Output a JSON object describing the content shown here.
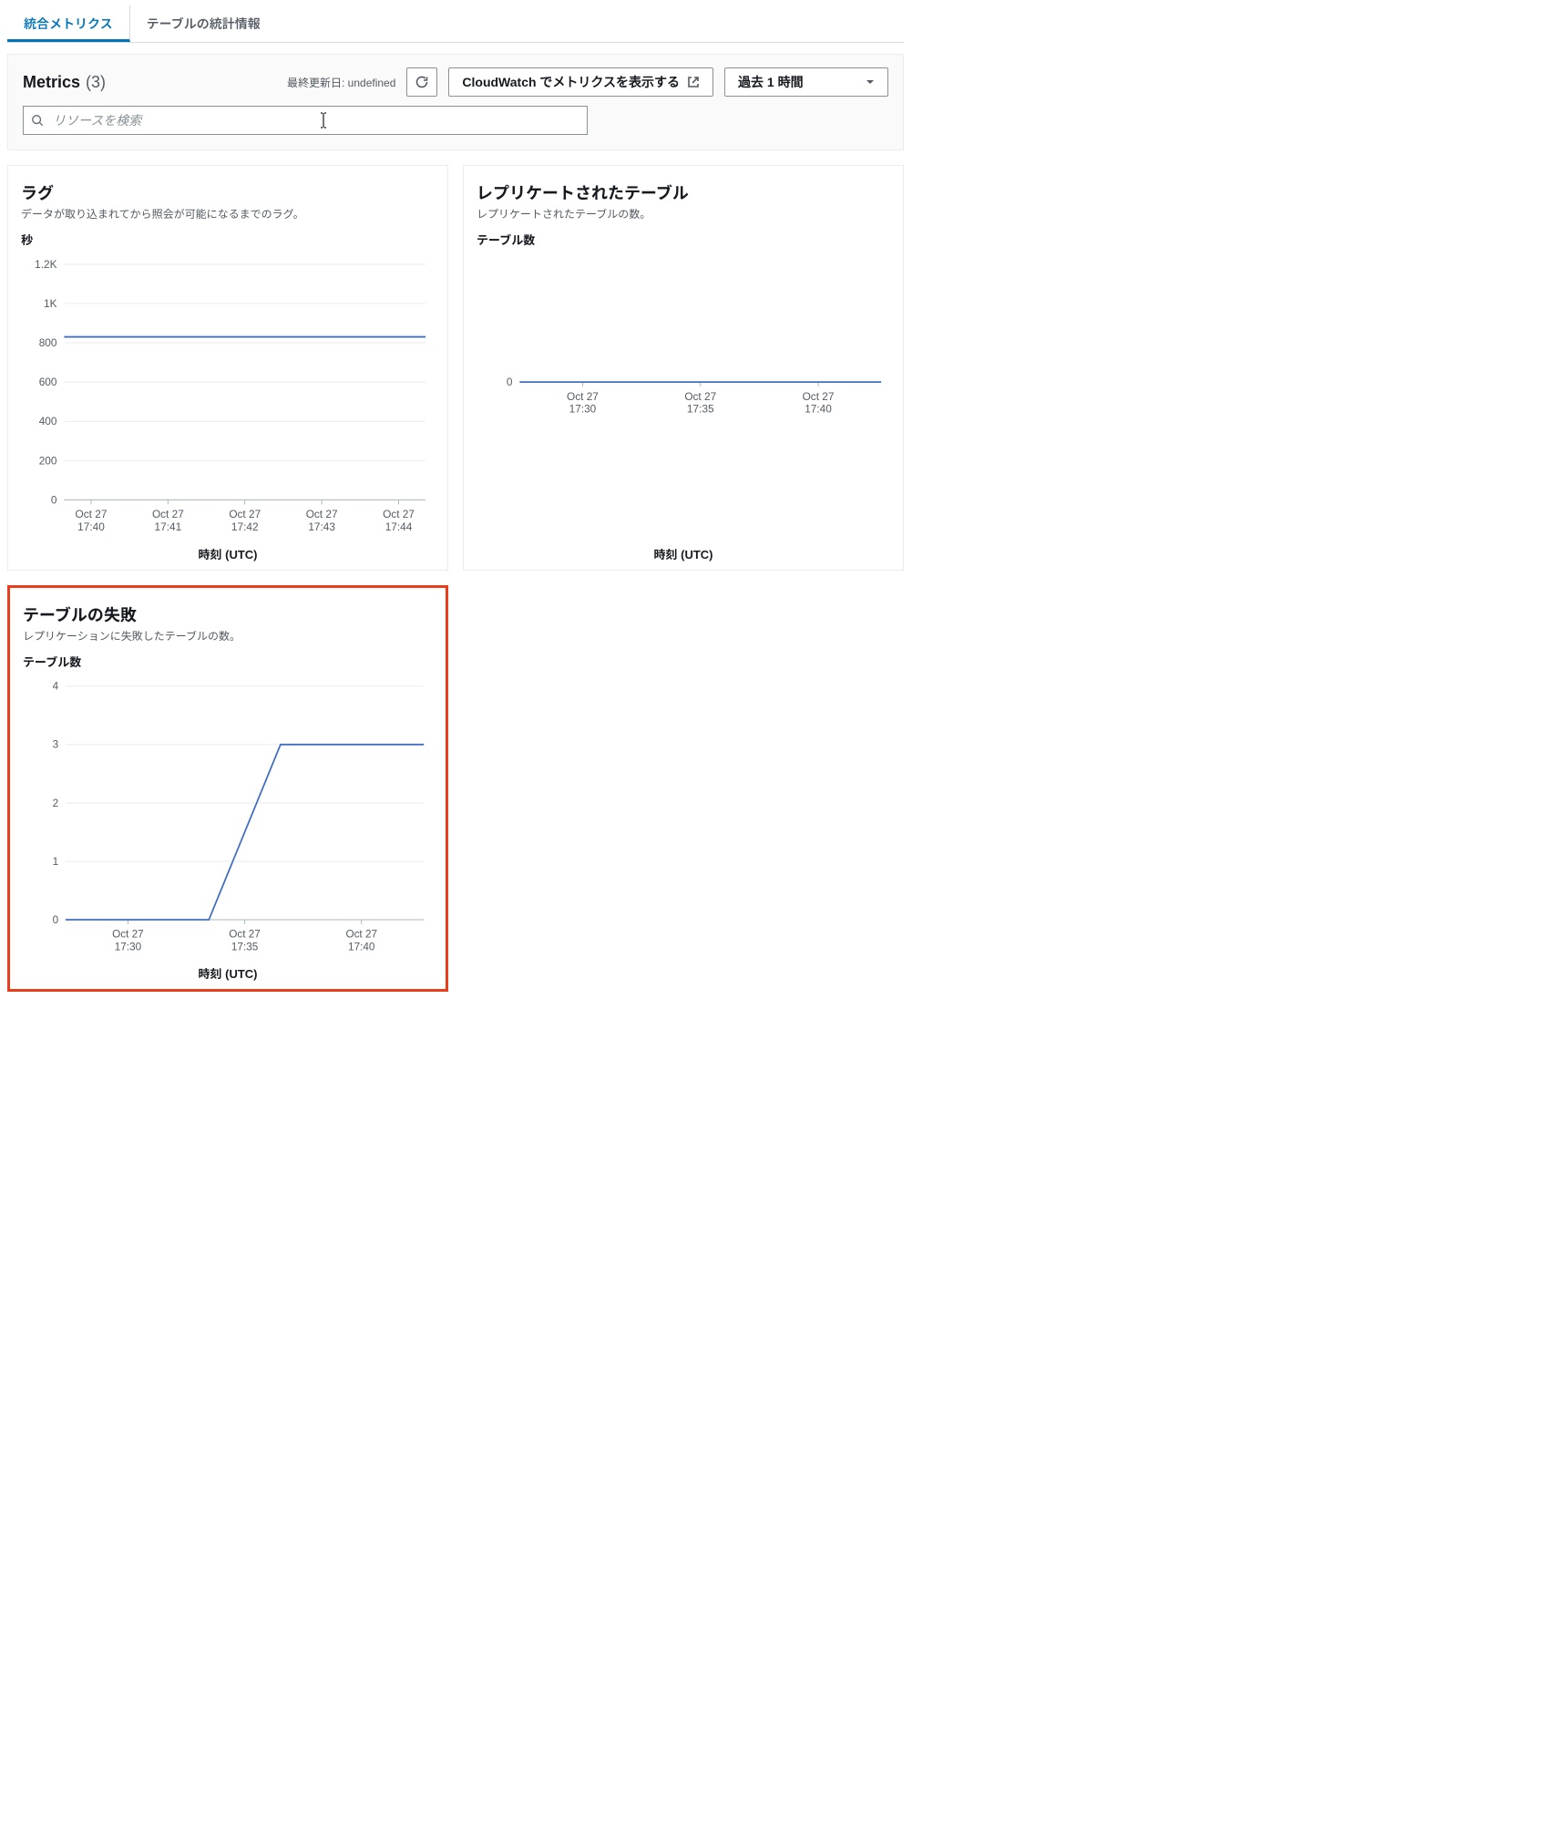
{
  "tabs": {
    "integrated_metrics": "統合メトリクス",
    "table_stats": "テーブルの統計情報"
  },
  "panel": {
    "title": "Metrics",
    "count": "(3)",
    "last_updated_label": "最終更新日: undefined",
    "cloudwatch_btn": "CloudWatch でメトリクスを表示する",
    "time_range": "過去 1 時間",
    "search_placeholder": "リソースを検索"
  },
  "charts": {
    "lag": {
      "title": "ラグ",
      "sub": "データが取り込まれてから照会が可能になるまでのラグ。",
      "ylabel": "秒",
      "xlabel": "時刻 (UTC)"
    },
    "replicated": {
      "title": "レプリケートされたテーブル",
      "sub": "レプリケートされたテーブルの数。",
      "ylabel": "テーブル数",
      "xlabel": "時刻 (UTC)"
    },
    "failed": {
      "title": "テーブルの失敗",
      "sub": "レプリケーションに失敗したテーブルの数。",
      "ylabel": "テーブル数",
      "xlabel": "時刻 (UTC)"
    }
  },
  "chart_data": [
    {
      "id": "lag",
      "type": "line",
      "title": "ラグ — 秒",
      "xlabel": "時刻 (UTC)",
      "ylabel": "秒",
      "x_tick_labels": [
        "Oct 27 17:40",
        "Oct 27 17:41",
        "Oct 27 17:42",
        "Oct 27 17:43",
        "Oct 27 17:44"
      ],
      "y_ticks": [
        0,
        200,
        400,
        600,
        800,
        1000,
        1200
      ],
      "y_tick_labels": [
        "0",
        "200",
        "400",
        "600",
        "800",
        "1K",
        "1.2K"
      ],
      "ylim": [
        0,
        1200
      ],
      "series": [
        {
          "name": "lag",
          "x": [
            "17:40",
            "17:41",
            "17:42",
            "17:43",
            "17:44"
          ],
          "values": [
            830,
            830,
            830,
            830,
            830
          ]
        }
      ]
    },
    {
      "id": "replicated",
      "type": "line",
      "title": "レプリケートされたテーブル — テーブル数",
      "xlabel": "時刻 (UTC)",
      "ylabel": "テーブル数",
      "x_tick_labels": [
        "Oct 27 17:30",
        "Oct 27 17:35",
        "Oct 27 17:40"
      ],
      "y_ticks": [
        0
      ],
      "y_tick_labels": [
        "0"
      ],
      "ylim": [
        0,
        1
      ],
      "series": [
        {
          "name": "replicated_tables",
          "x": [
            "17:30",
            "17:35",
            "17:40"
          ],
          "values": [
            0,
            0,
            0
          ]
        }
      ]
    },
    {
      "id": "failed",
      "type": "line",
      "title": "テーブルの失敗 — テーブル数",
      "xlabel": "時刻 (UTC)",
      "ylabel": "テーブル数",
      "x_tick_labels": [
        "Oct 27 17:30",
        "Oct 27 17:35",
        "Oct 27 17:40"
      ],
      "y_ticks": [
        0,
        1,
        2,
        3,
        4
      ],
      "y_tick_labels": [
        "0",
        "1",
        "2",
        "3",
        "4"
      ],
      "ylim": [
        0,
        4
      ],
      "series": [
        {
          "name": "failed_tables",
          "x": [
            "17:27",
            "17:30",
            "17:35",
            "17:37",
            "17:40",
            "17:45"
          ],
          "values": [
            0,
            0,
            0,
            3,
            3,
            3
          ]
        }
      ]
    }
  ]
}
